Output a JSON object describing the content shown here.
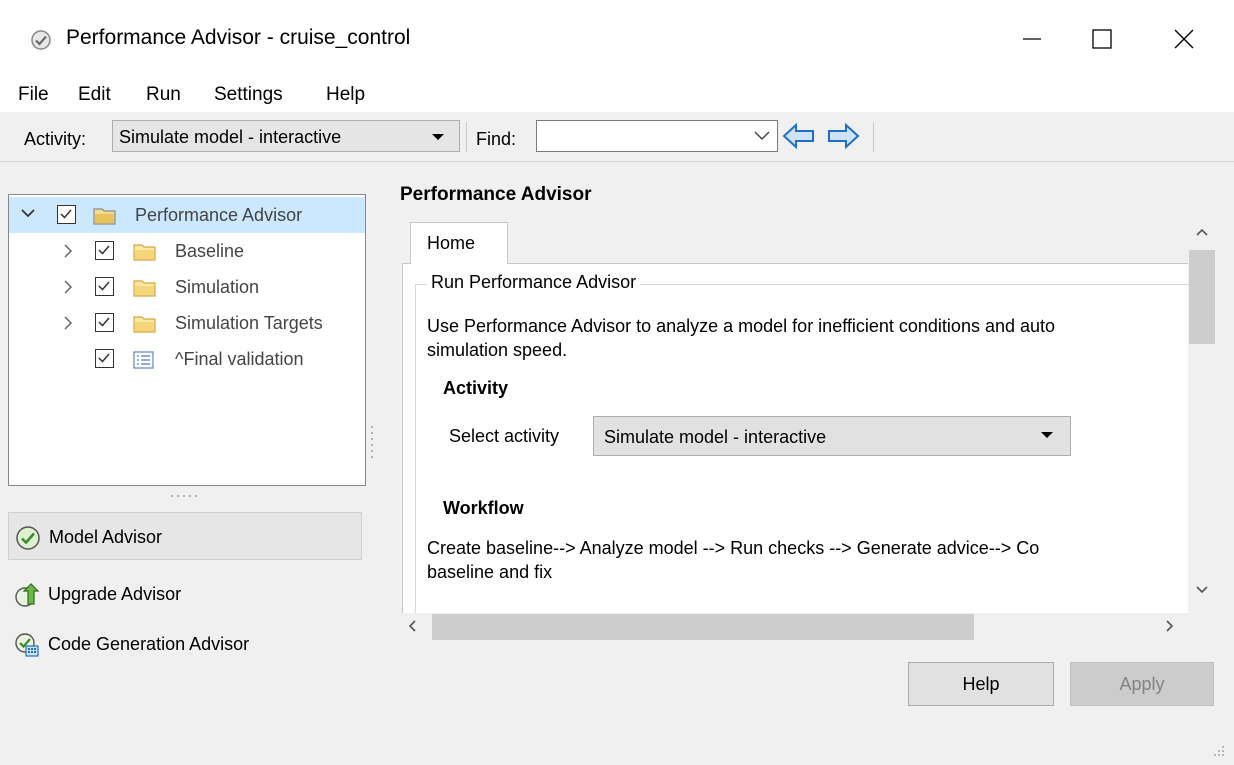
{
  "window": {
    "title": "Performance Advisor - cruise_control",
    "icon": "check-circle-icon",
    "controls": [
      "minimize-icon",
      "maximize-icon",
      "close-icon"
    ]
  },
  "menubar": {
    "items": [
      "File",
      "Edit",
      "Run",
      "Settings",
      "Help"
    ]
  },
  "toolbar": {
    "activity_label": "Activity:",
    "activity_value": "Simulate model - interactive",
    "find_label": "Find:",
    "find_value": "",
    "back_icon": "arrow-left-icon",
    "forward_icon": "arrow-right-icon"
  },
  "tree": {
    "items": [
      {
        "label": "Performance Advisor",
        "checked": true,
        "expanded": true,
        "icon": "folder-icon",
        "selected": true
      },
      {
        "label": "Baseline",
        "checked": true,
        "expanded": false,
        "icon": "folder-icon"
      },
      {
        "label": "Simulation",
        "checked": true,
        "expanded": false,
        "icon": "folder-icon"
      },
      {
        "label": "Simulation Targets",
        "checked": true,
        "expanded": false,
        "icon": "folder-icon"
      },
      {
        "label": "^Final validation",
        "checked": true,
        "icon": "task-list-icon"
      }
    ]
  },
  "advisors": [
    {
      "label": "Model Advisor",
      "icon": "model-advisor-icon",
      "selected": true
    },
    {
      "label": "Upgrade Advisor",
      "icon": "upgrade-advisor-icon"
    },
    {
      "label": "Code Generation Advisor",
      "icon": "code-gen-advisor-icon"
    }
  ],
  "main": {
    "heading": "Performance Advisor",
    "tabs": [
      {
        "label": "Home"
      }
    ],
    "group_title": "Run Performance Advisor",
    "intro_line1": "Use Performance Advisor to analyze a model for inefficient conditions and auto",
    "intro_line2": "simulation speed.",
    "activity_heading": "Activity",
    "select_activity_label": "Select activity",
    "select_activity_value": "Simulate model - interactive",
    "workflow_heading": "Workflow",
    "workflow_line1": "Create baseline--> Analyze model --> Run checks --> Generate advice--> Co",
    "workflow_line2": "baseline and fix"
  },
  "buttons": {
    "help": "Help",
    "apply": "Apply",
    "apply_enabled": false
  },
  "colors": {
    "selection": "#cce8ff",
    "arrow_fill": "#cfe3f7",
    "arrow_stroke": "#1f6fc4",
    "folder": "#e8c25a"
  }
}
